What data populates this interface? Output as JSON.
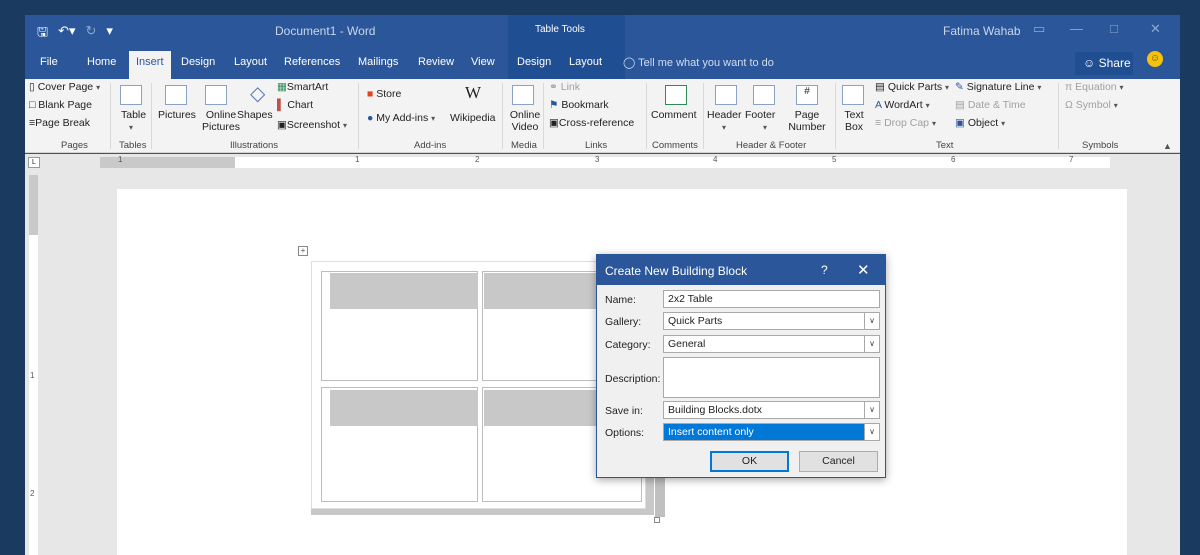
{
  "titlebar": {
    "doc_title": "Document1  -  Word",
    "context_tab_group": "Table Tools",
    "user": "Fatima Wahab"
  },
  "tabs": {
    "file": "File",
    "home": "Home",
    "insert": "Insert",
    "design": "Design",
    "layout": "Layout",
    "references": "References",
    "mailings": "Mailings",
    "review": "Review",
    "view": "View",
    "tt_design": "Design",
    "tt_layout": "Layout",
    "tell_me": "Tell me what you want to do",
    "share": "Share"
  },
  "ribbon": {
    "pages": {
      "cover_page": "Cover Page",
      "blank_page": "Blank Page",
      "page_break": "Page Break",
      "label": "Pages"
    },
    "tables": {
      "table": "Table",
      "label": "Tables"
    },
    "illustrations": {
      "pictures": "Pictures",
      "online_pictures": "Online Pictures",
      "shapes": "Shapes",
      "smartart": "SmartArt",
      "chart": "Chart",
      "screenshot": "Screenshot",
      "label": "Illustrations"
    },
    "addins": {
      "store": "Store",
      "my_addins": "My Add-ins",
      "wikipedia": "Wikipedia",
      "label": "Add-ins"
    },
    "media": {
      "online_video": "Online Video",
      "label": "Media"
    },
    "links": {
      "link": "Link",
      "bookmark": "Bookmark",
      "cross_reference": "Cross-reference",
      "label": "Links"
    },
    "comments": {
      "comment": "Comment",
      "label": "Comments"
    },
    "header_footer": {
      "header": "Header",
      "footer": "Footer",
      "page_number": "Page Number",
      "label": "Header & Footer"
    },
    "text": {
      "text_box": "Text Box",
      "quick_parts": "Quick Parts",
      "wordart": "WordArt",
      "drop_cap": "Drop Cap",
      "signature_line": "Signature Line",
      "date_time": "Date & Time",
      "object": "Object",
      "label": "Text"
    },
    "symbols": {
      "equation": "Equation",
      "symbol": "Symbol",
      "label": "Symbols"
    }
  },
  "ruler": {
    "numbers": [
      "1",
      "1",
      "2",
      "3",
      "4",
      "5",
      "6",
      "7"
    ],
    "vnumbers": [
      "1",
      "2"
    ]
  },
  "dialog": {
    "title": "Create New Building Block",
    "help": "?",
    "name_label": "Name:",
    "name_value": "2x2 Table",
    "gallery_label": "Gallery:",
    "gallery_value": "Quick Parts",
    "category_label": "Category:",
    "category_value": "General",
    "description_label": "Description:",
    "description_value": "",
    "savein_label": "Save in:",
    "savein_value": "Building Blocks.dotx",
    "options_label": "Options:",
    "options_value": "Insert content only",
    "ok": "OK",
    "cancel": "Cancel"
  },
  "colors": {
    "word_blue": "#2b579a",
    "selection_blue": "#0078d7"
  }
}
